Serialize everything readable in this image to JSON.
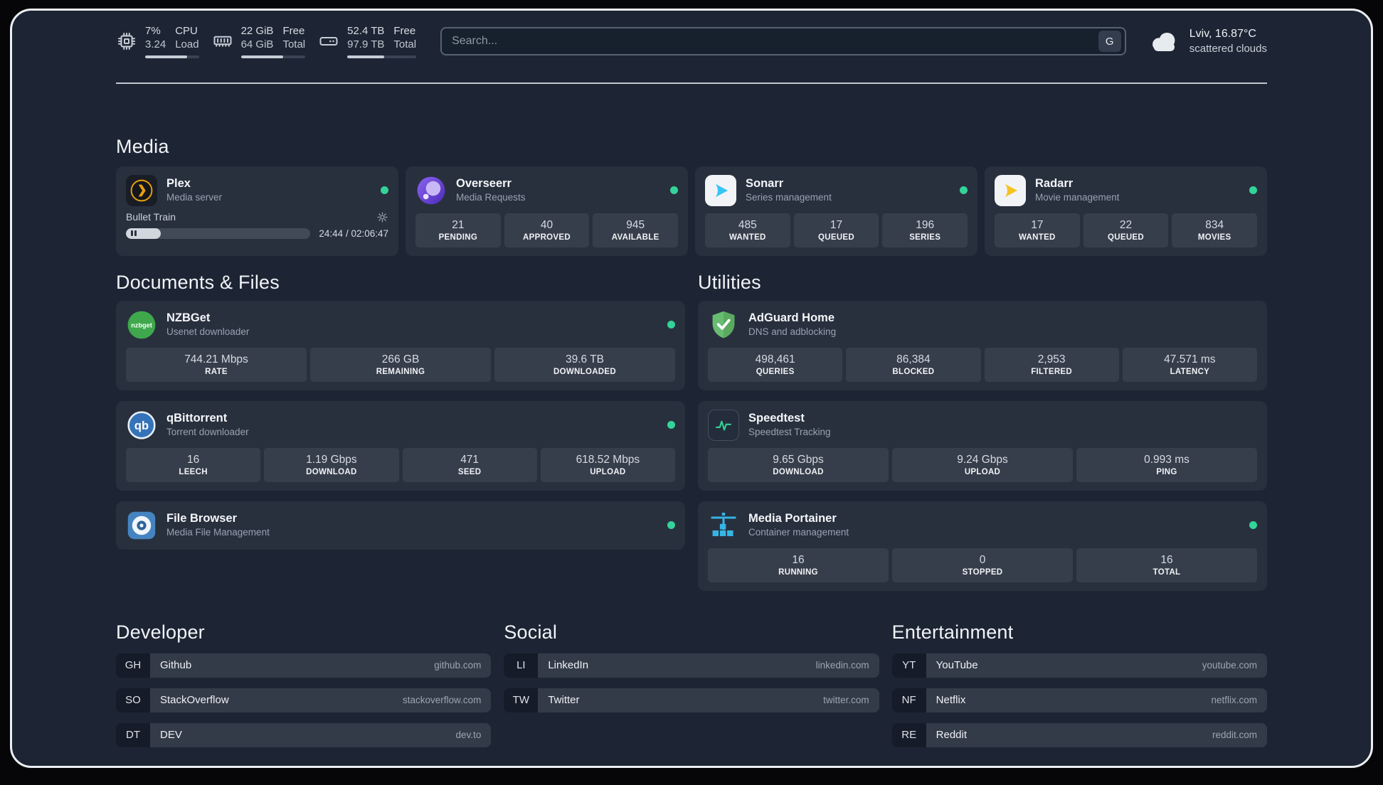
{
  "colors": {
    "background": "#1d2534",
    "card": "rgba(255,255,255,0.05)",
    "online_dot": "#34d399",
    "plex_gold": "#e5a00d",
    "sonarr_blue": "#35c5f4",
    "radarr_gold": "#f6c422",
    "adguard_green": "#68bc71",
    "portainer_blue": "#36b5e5"
  },
  "topbar": {
    "cpu": {
      "value": "7%",
      "sub": "3.24",
      "label_top": "CPU",
      "label_bottom": "Load",
      "bar_percent": 78
    },
    "memory": {
      "value": "22 GiB",
      "sub": "64 GiB",
      "label_top": "Free",
      "label_bottom": "Total",
      "bar_percent": 66
    },
    "disk": {
      "value": "52.4 TB",
      "sub": "97.9 TB",
      "label_top": "Free",
      "label_bottom": "Total",
      "bar_percent": 54
    },
    "search": {
      "placeholder": "Search...",
      "provider_label": "G"
    },
    "weather": {
      "location": "Lviv, 16.87°C",
      "condition": "scattered clouds"
    }
  },
  "icons": {
    "nzbget_label": "nzbget",
    "qbittorrent_label": "qb"
  },
  "media": {
    "title": "Media",
    "plex": {
      "name": "Plex",
      "desc": "Media server",
      "status": "online",
      "track": "Bullet Train",
      "time": "24:44 / 02:06:47",
      "progress_percent": 19
    },
    "overseerr": {
      "name": "Overseerr",
      "desc": "Media Requests",
      "status": "online",
      "stats": [
        {
          "value": "21",
          "label": "PENDING"
        },
        {
          "value": "40",
          "label": "APPROVED"
        },
        {
          "value": "945",
          "label": "AVAILABLE"
        }
      ]
    },
    "sonarr": {
      "name": "Sonarr",
      "desc": "Series management",
      "status": "online",
      "stats": [
        {
          "value": "485",
          "label": "WANTED"
        },
        {
          "value": "17",
          "label": "QUEUED"
        },
        {
          "value": "196",
          "label": "SERIES"
        }
      ]
    },
    "radarr": {
      "name": "Radarr",
      "desc": "Movie management",
      "status": "online",
      "stats": [
        {
          "value": "17",
          "label": "WANTED"
        },
        {
          "value": "22",
          "label": "QUEUED"
        },
        {
          "value": "834",
          "label": "MOVIES"
        }
      ]
    }
  },
  "documents": {
    "title": "Documents & Files",
    "nzbget": {
      "name": "NZBGet",
      "desc": "Usenet downloader",
      "status": "online",
      "stats": [
        {
          "value": "744.21 Mbps",
          "label": "RATE"
        },
        {
          "value": "266 GB",
          "label": "REMAINING"
        },
        {
          "value": "39.6 TB",
          "label": "DOWNLOADED"
        }
      ]
    },
    "qbittorrent": {
      "name": "qBittorrent",
      "desc": "Torrent downloader",
      "status": "online",
      "stats": [
        {
          "value": "16",
          "label": "LEECH"
        },
        {
          "value": "1.19 Gbps",
          "label": "DOWNLOAD"
        },
        {
          "value": "471",
          "label": "SEED"
        },
        {
          "value": "618.52 Mbps",
          "label": "UPLOAD"
        }
      ]
    },
    "filebrowser": {
      "name": "File Browser",
      "desc": "Media File Management",
      "status": "online"
    }
  },
  "utilities": {
    "title": "Utilities",
    "adguard": {
      "name": "AdGuard Home",
      "desc": "DNS and adblocking",
      "stats": [
        {
          "value": "498,461",
          "label": "QUERIES"
        },
        {
          "value": "86,384",
          "label": "BLOCKED"
        },
        {
          "value": "2,953",
          "label": "FILTERED"
        },
        {
          "value": "47.571 ms",
          "label": "LATENCY"
        }
      ]
    },
    "speedtest": {
      "name": "Speedtest",
      "desc": "Speedtest Tracking",
      "stats": [
        {
          "value": "9.65 Gbps",
          "label": "DOWNLOAD"
        },
        {
          "value": "9.24 Gbps",
          "label": "UPLOAD"
        },
        {
          "value": "0.993 ms",
          "label": "PING"
        }
      ]
    },
    "portainer": {
      "name": "Media Portainer",
      "desc": "Container management",
      "status": "online",
      "stats": [
        {
          "value": "16",
          "label": "RUNNING"
        },
        {
          "value": "0",
          "label": "STOPPED"
        },
        {
          "value": "16",
          "label": "TOTAL"
        }
      ]
    }
  },
  "bookmarks": {
    "developer": {
      "title": "Developer",
      "items": [
        {
          "abbr": "GH",
          "name": "Github",
          "domain": "github.com"
        },
        {
          "abbr": "SO",
          "name": "StackOverflow",
          "domain": "stackoverflow.com"
        },
        {
          "abbr": "DT",
          "name": "DEV",
          "domain": "dev.to"
        }
      ]
    },
    "social": {
      "title": "Social",
      "items": [
        {
          "abbr": "LI",
          "name": "LinkedIn",
          "domain": "linkedin.com"
        },
        {
          "abbr": "TW",
          "name": "Twitter",
          "domain": "twitter.com"
        }
      ]
    },
    "entertainment": {
      "title": "Entertainment",
      "items": [
        {
          "abbr": "YT",
          "name": "YouTube",
          "domain": "youtube.com"
        },
        {
          "abbr": "NF",
          "name": "Netflix",
          "domain": "netflix.com"
        },
        {
          "abbr": "RE",
          "name": "Reddit",
          "domain": "reddit.com"
        }
      ]
    }
  }
}
